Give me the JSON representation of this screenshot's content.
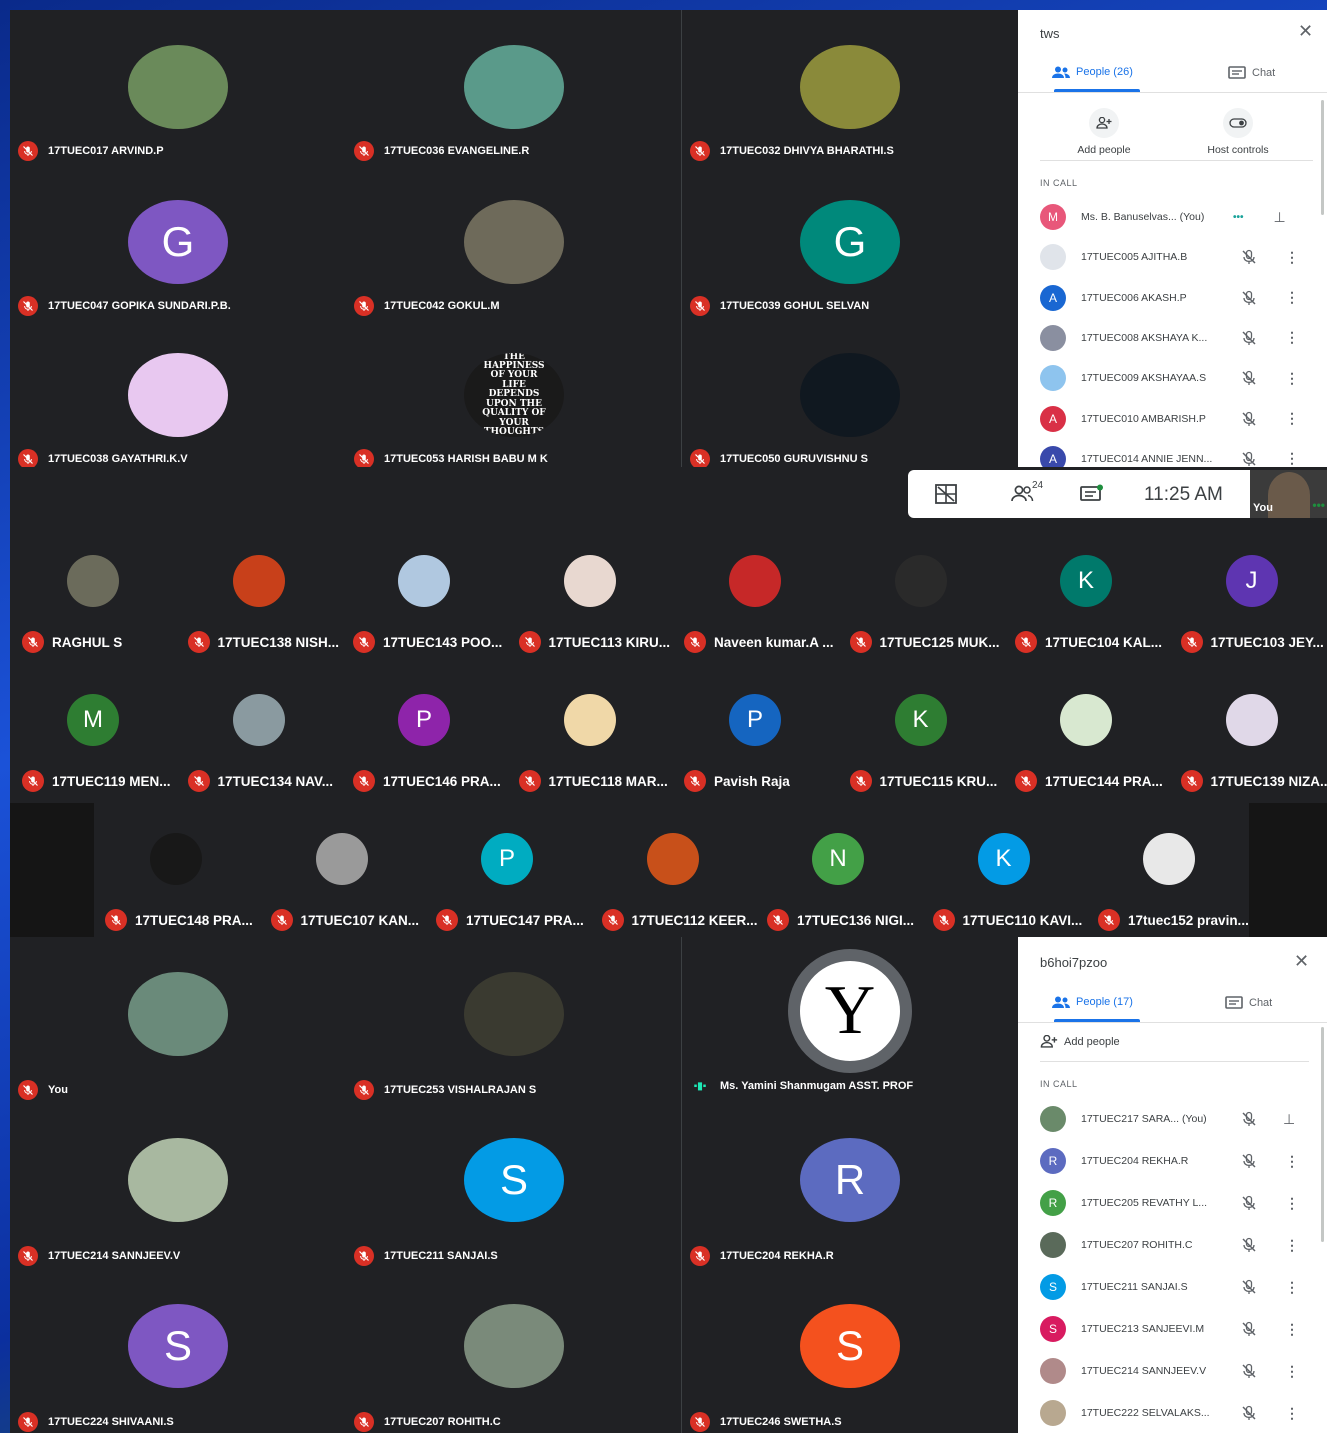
{
  "meeting1": {
    "title": "tws",
    "tabs": {
      "people": "People (26)",
      "chat": "Chat"
    },
    "actions": {
      "add_people": "Add people",
      "host_controls": "Host controls"
    },
    "in_call_label": "IN CALL",
    "tiles": [
      {
        "name": "17TUEC017 ARVIND.P",
        "bg": "#6a8a5a"
      },
      {
        "name": "17TUEC036 EVANGELINE.R",
        "bg": "#5a9a8a"
      },
      {
        "name": "17TUEC032 DHIVYA BHARATHI.S",
        "bg": "#8a8a3a"
      },
      {
        "name": "17TUEC047 GOPIKA SUNDARI.P.B.",
        "initial": "G",
        "bg": "#7e57c2"
      },
      {
        "name": "17TUEC042 GOKUL.M",
        "bg": "#6e6a5a"
      },
      {
        "name": "17TUEC039 GOHUL SELVAN",
        "initial": "G",
        "bg": "#00897b"
      },
      {
        "name": "17TUEC038 GAYATHRI.K.V",
        "bg": "#e8c8f0"
      },
      {
        "name": "17TUEC053 HARISH BABU M K",
        "bg": "#1a1a1a",
        "quote": "THE HAPPINESS OF YOUR LIFE DEPENDS UPON THE QUALITY OF YOUR THOUGHTS"
      },
      {
        "name": "17TUEC050 GURUVISHNU S",
        "bg": "#101820"
      }
    ],
    "participants": [
      {
        "initial": "M",
        "color": "#e8577a",
        "name": "Ms. B. Banuselvas...",
        "suffix": "(You)"
      },
      {
        "initial": "",
        "color": "#e0e4ea",
        "name": "17TUEC005 AJITHA.B"
      },
      {
        "initial": "A",
        "color": "#1967d2",
        "name": "17TUEC006 AKASH.P"
      },
      {
        "initial": "",
        "color": "#8a8fa0",
        "name": "17TUEC008 AKSHAYA K..."
      },
      {
        "initial": "",
        "color": "#8ec4ee",
        "name": "17TUEC009 AKSHAYAA.S"
      },
      {
        "initial": "A",
        "color": "#d93046",
        "name": "17TUEC010 AMBARISH.P"
      },
      {
        "initial": "A",
        "color": "#3949ab",
        "name": "17TUEC014 ANNIE JENN..."
      }
    ]
  },
  "meeting2": {
    "participant_count": "24",
    "time": "11:25 AM",
    "self_label": "You",
    "row1": [
      {
        "name": "RAGHUL S",
        "bg": "#6b6b5b"
      },
      {
        "name": "17TUEC138 NISH...",
        "bg": "#c8401a"
      },
      {
        "name": "17TUEC143 POO...",
        "bg": "#b0c8e0"
      },
      {
        "name": "17TUEC113 KIRU...",
        "bg": "#e8d8d0"
      },
      {
        "name": "Naveen kumar.A ...",
        "bg": "#c62828"
      },
      {
        "name": "17TUEC125 MUK...",
        "bg": "#2a2a2a"
      },
      {
        "name": "17TUEC104 KAL...",
        "initial": "K",
        "bg": "#00796b"
      },
      {
        "name": "17TUEC103 JEY...",
        "initial": "J",
        "bg": "#5e35b1"
      }
    ],
    "row2": [
      {
        "name": "17TUEC119 MEN...",
        "initial": "M",
        "bg": "#2e7d32"
      },
      {
        "name": "17TUEC134 NAV...",
        "bg": "#8a9aa0"
      },
      {
        "name": "17TUEC146 PRA...",
        "initial": "P",
        "bg": "#8e24aa"
      },
      {
        "name": "17TUEC118 MAR...",
        "bg": "#f0d8a8"
      },
      {
        "name": "Pavish Raja",
        "initial": "P",
        "bg": "#1565c0"
      },
      {
        "name": "17TUEC115 KRU...",
        "initial": "K",
        "bg": "#2e7d32"
      },
      {
        "name": "17TUEC144 PRA...",
        "bg": "#d8e8d0"
      },
      {
        "name": "17TUEC139 NIZA...",
        "bg": "#e0d8e8"
      }
    ],
    "row3": [
      {
        "name": "17TUEC148 PRA...",
        "bg": "#181818"
      },
      {
        "name": "17TUEC107 KAN...",
        "bg": "#9a9a9a"
      },
      {
        "name": "17TUEC147 PRA...",
        "initial": "P",
        "bg": "#00acc1"
      },
      {
        "name": "17TUEC112 KEER...",
        "bg": "#c8501a"
      },
      {
        "name": "17TUEC136 NIGI...",
        "initial": "N",
        "bg": "#43a047"
      },
      {
        "name": "17TUEC110 KAVI...",
        "initial": "K",
        "bg": "#039be5"
      },
      {
        "name": "17tuec152 pravin...",
        "bg": "#e8e8e8"
      }
    ]
  },
  "meeting3": {
    "title": "b6hoi7pzoo",
    "tabs": {
      "people": "People (17)",
      "chat": "Chat"
    },
    "actions": {
      "add_people": "Add people"
    },
    "in_call_label": "IN CALL",
    "tiles": [
      {
        "name": "You",
        "bg": "#6a8a7a"
      },
      {
        "name": "17TUEC253 VISHALRAJAN S",
        "bg": "#3a3a30"
      },
      {
        "name": "Ms. Yamini Shanmugam ASST. PROF",
        "bg": "#ffffff",
        "speaking": true
      },
      {
        "name": "17TUEC214 SANNJEEV.V",
        "bg": "#a8b8a0"
      },
      {
        "name": "17TUEC211 SANJAI.S",
        "initial": "S",
        "bg": "#039be5"
      },
      {
        "name": "17TUEC204 REKHA.R",
        "initial": "R",
        "bg": "#5c6bc0"
      },
      {
        "name": "17TUEC224 SHIVAANI.S",
        "initial": "S",
        "bg": "#7e57c2"
      },
      {
        "name": "17TUEC207 ROHITH.C",
        "bg": "#7a8a7a"
      },
      {
        "name": "17TUEC246 SWETHA.S",
        "initial": "S",
        "bg": "#f4511e"
      }
    ],
    "participants": [
      {
        "initial": "",
        "color": "#6a8a6a",
        "name": "17TUEC217 SARA...",
        "suffix": "(You)"
      },
      {
        "initial": "R",
        "color": "#5c6bc0",
        "name": "17TUEC204 REKHA.R"
      },
      {
        "initial": "R",
        "color": "#43a047",
        "name": "17TUEC205 REVATHY L..."
      },
      {
        "initial": "",
        "color": "#5a6a5a",
        "name": "17TUEC207 ROHITH.C"
      },
      {
        "initial": "S",
        "color": "#039be5",
        "name": "17TUEC211 SANJAI.S"
      },
      {
        "initial": "S",
        "color": "#d81b60",
        "name": "17TUEC213 SANJEEVI.M"
      },
      {
        "initial": "",
        "color": "#b08a8a",
        "name": "17TUEC214 SANNJEEV.V"
      },
      {
        "initial": "",
        "color": "#b8a890",
        "name": "17TUEC222 SELVALAKS..."
      }
    ]
  }
}
